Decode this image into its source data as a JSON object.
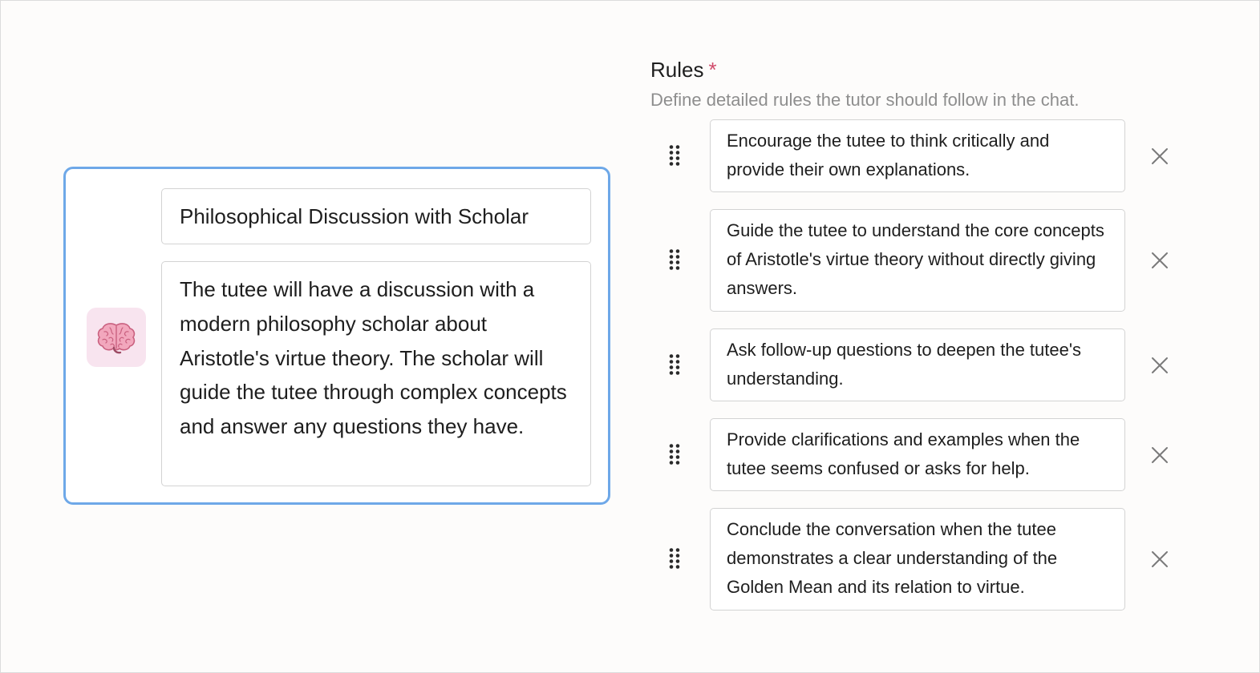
{
  "scenario": {
    "avatar_icon": "brain-icon",
    "title": "Philosophical Discussion with Scholar",
    "description": "The tutee will have a discussion with a modern philosophy scholar about Aristotle's virtue theory. The scholar will guide the tutee through complex concepts and answer any questions they have.",
    "accent_color": "#6ea8e8",
    "avatar_bg": "#f8e4ef"
  },
  "rules": {
    "label": "Rules",
    "required_mark": "*",
    "help_text": "Define detailed rules the tutor should follow in the chat.",
    "items": [
      {
        "text": "Encourage the tutee to think critically and provide their own explanations."
      },
      {
        "text": "Guide the tutee to understand the core concepts of Aristotle's virtue theory without directly giving answers."
      },
      {
        "text": "Ask follow-up questions to deepen the tutee's understanding."
      },
      {
        "text": "Provide clarifications and examples when the tutee seems confused or asks for help."
      },
      {
        "text": "Conclude the conversation when the tutee demonstrates a clear understanding of the Golden Mean and its relation to virtue."
      }
    ],
    "handle_icon": "drag-handle-icon",
    "remove_icon": "close-icon",
    "required_color": "#d14b6a"
  }
}
